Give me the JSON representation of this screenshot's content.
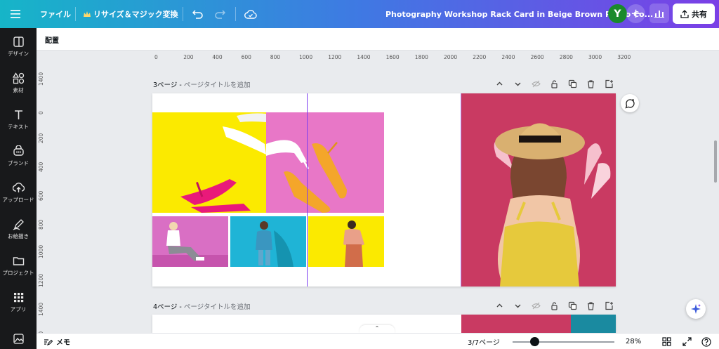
{
  "topbar": {
    "menu_icon": "hamburger-icon",
    "file_label": "ファイル",
    "resize_label": "リサイズ＆マジック変換",
    "doc_title": "Photography Workshop Rack Card in Beige Brown Photo Co...",
    "avatar_initial": "Y",
    "share_label": "共有"
  },
  "toolbar": {
    "position_label": "配置"
  },
  "sidebar": {
    "items": [
      {
        "label": "デザイン",
        "icon": "design-icon"
      },
      {
        "label": "素材",
        "icon": "elements-icon"
      },
      {
        "label": "テキスト",
        "icon": "text-icon"
      },
      {
        "label": "ブランド",
        "icon": "brand-icon"
      },
      {
        "label": "アップロード",
        "icon": "upload-icon"
      },
      {
        "label": "お絵描き",
        "icon": "draw-icon"
      },
      {
        "label": "プロジェクト",
        "icon": "folder-icon"
      },
      {
        "label": "アプリ",
        "icon": "apps-icon"
      }
    ]
  },
  "ruler": {
    "h_ticks": [
      "0",
      "200",
      "400",
      "600",
      "800",
      "1000",
      "1200",
      "1400",
      "1600",
      "1800",
      "2000",
      "2200",
      "2400",
      "2600",
      "2800",
      "3000",
      "3200"
    ],
    "v_ticks": [
      "1400",
      "0",
      "200",
      "400",
      "600",
      "800",
      "1000",
      "1200",
      "1400",
      "1600"
    ]
  },
  "pages": [
    {
      "number": "3ページ",
      "sep": " - ",
      "title_placeholder": "ページタイトルを追加"
    },
    {
      "number": "4ページ",
      "sep": " - ",
      "title_placeholder": "ページタイトルを追加"
    }
  ],
  "bottombar": {
    "notes_label": "メモ",
    "page_indicator": "3/7ページ",
    "zoom_percent": "28%",
    "zoom_level": 0.28
  },
  "colors": {
    "yellow": "#fbea00",
    "pink": "#e877c7",
    "crimson": "#c93a62",
    "cyan": "#1fb4d6",
    "accent": "#7d3df0"
  }
}
